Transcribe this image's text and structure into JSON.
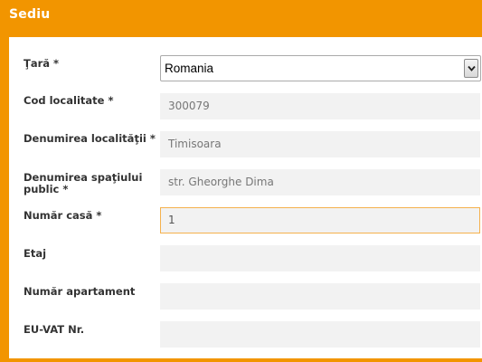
{
  "panel": {
    "title": "Sediu"
  },
  "fields": {
    "country": {
      "label": "Ţară *",
      "value": "Romania"
    },
    "locality_code": {
      "label": "Cod localitate *",
      "value": "300079"
    },
    "locality_name": {
      "label": "Denumirea localităţii *",
      "value": "Timisoara"
    },
    "public_space": {
      "label": "Denumirea spaţiului public *",
      "value": "str. Gheorghe Dima"
    },
    "house_number": {
      "label": "Număr casă *",
      "value": "1"
    },
    "floor": {
      "label": "Etaj",
      "value": ""
    },
    "apartment": {
      "label": "Număr apartament",
      "value": ""
    },
    "eu_vat": {
      "label": "EU-VAT Nr.",
      "value": ""
    }
  },
  "colors": {
    "accent": "#f29500",
    "active_border": "#f5b14d",
    "field_bg": "#f2f2f2"
  },
  "icons": {
    "select_arrow": "chevron-down-icon"
  }
}
